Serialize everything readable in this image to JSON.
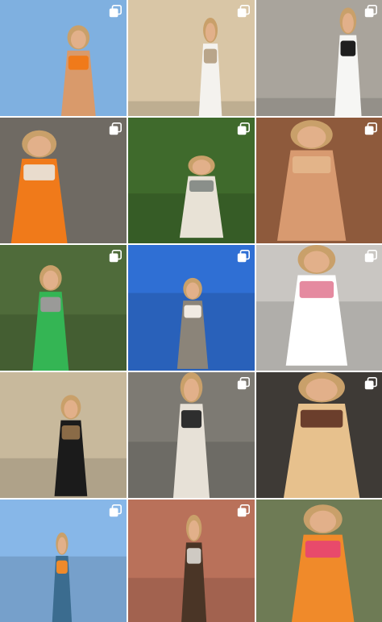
{
  "grid": {
    "columns": 3,
    "rows": 5,
    "posts": [
      {
        "scene": "selfie-orange-bikini-holding-orange",
        "multiple": true,
        "colors": [
          "#7fb0e0",
          "#d99a6b",
          "#f07a1a"
        ]
      },
      {
        "scene": "white-dress-beige-handbag-by-stone-wall",
        "multiple": true,
        "colors": [
          "#d9c6a6",
          "#f4f2ee",
          "#b9a58a"
        ]
      },
      {
        "scene": "white-shirt-black-bag-street",
        "multiple": true,
        "colors": [
          "#a9a49c",
          "#f6f6f4",
          "#1e1e1e"
        ]
      },
      {
        "scene": "orange-bikini-floral-skirt-on-rocks",
        "multiple": true,
        "colors": [
          "#6f6a63",
          "#f07a1a",
          "#e9dccd"
        ]
      },
      {
        "scene": "white-lace-dress-sitting-in-park",
        "multiple": true,
        "colors": [
          "#3f6a2c",
          "#e8e2d6",
          "#8a8f8a"
        ]
      },
      {
        "scene": "sunlit-face-close-up",
        "multiple": true,
        "colors": [
          "#8e5a3c",
          "#d89a70",
          "#e3b489"
        ]
      },
      {
        "scene": "green-dress-street",
        "multiple": true,
        "colors": [
          "#4f6b3a",
          "#34b554",
          "#9a9a98"
        ]
      },
      {
        "scene": "white-top-skirt-on-rocks-blue-sky",
        "multiple": true,
        "colors": [
          "#2f6fd4",
          "#8b8479",
          "#f1ebe3"
        ]
      },
      {
        "scene": "white-shirt-pink-striped-skirt-cobblestone",
        "multiple": true,
        "colors": [
          "#c9c6c2",
          "#ffffff",
          "#e58aa0"
        ]
      },
      {
        "scene": "black-blazer-dress-old-street",
        "multiple": false,
        "colors": [
          "#c8b99c",
          "#1b1b1b",
          "#8a6b47"
        ]
      },
      {
        "scene": "walking-white-outfit-building",
        "multiple": true,
        "colors": [
          "#7d7a73",
          "#e7e1d7",
          "#2e2e2e"
        ]
      },
      {
        "scene": "car-selfie-brown-blazer",
        "multiple": true,
        "colors": [
          "#3e3a36",
          "#e7c18d",
          "#6b3e2c"
        ]
      },
      {
        "scene": "orange-outfit-seaside-rocks",
        "multiple": true,
        "colors": [
          "#87b7e8",
          "#3b6c8f",
          "#ef8a2a"
        ]
      },
      {
        "scene": "brown-jacket-city-street",
        "multiple": true,
        "colors": [
          "#b9715a",
          "#4a3526",
          "#cfcac3"
        ]
      },
      {
        "scene": "orange-top-pink-hair-flower",
        "multiple": false,
        "colors": [
          "#6e7b55",
          "#f08a2a",
          "#e84a6b"
        ]
      }
    ]
  },
  "icons": {
    "multiple": "multiple-posts-icon"
  },
  "accent": "#ffffff"
}
